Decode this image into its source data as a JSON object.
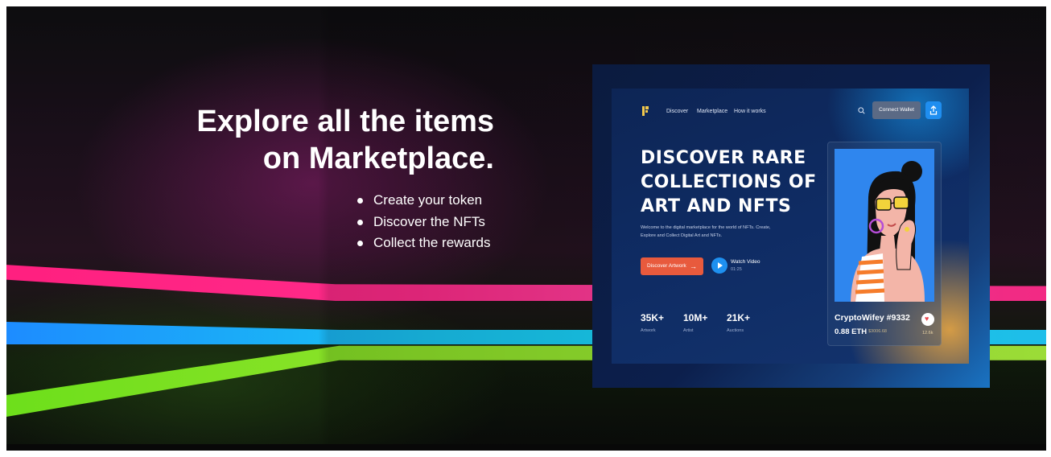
{
  "headline": {
    "line1": "Explore all the items",
    "line2": "on Marketplace."
  },
  "bullets": [
    "Create your token",
    "Discover the NFTs",
    "Collect the rewards"
  ],
  "mockup": {
    "nav": {
      "items": [
        "Discover",
        "Marketplace",
        "How it works"
      ],
      "connect_label": "Connect Wallet"
    },
    "hero": {
      "line1": "DISCOVER RARE",
      "line2": "COLLECTIONS OF",
      "line3": "ART AND NFTS",
      "desc_line1": "Welcome to the digital marketplace for the world of NFTs. Create,",
      "desc_line2": "Explore and Collect Digital Art and NFTs."
    },
    "discover_label": "Discover Artwork",
    "discover_arrow": "→",
    "watch_label": "Watch Video",
    "watch_time": "01:25",
    "stats": [
      {
        "value": "35K+",
        "label": "Artwork"
      },
      {
        "value": "10M+",
        "label": "Artist"
      },
      {
        "value": "21K+",
        "label": "Auctions"
      }
    ],
    "nft": {
      "title": "CryptoWifey #9332",
      "price": "0.88 ETH",
      "usd": "$3006.68",
      "likes": "12.6k"
    }
  },
  "colors": {
    "pink": "#ff2b8a",
    "blue": "#19c4f2",
    "green": "#8fe32a",
    "discover_button": "#e85a3d",
    "accent_blue": "#1f8ef0"
  },
  "icons": [
    "logo-icon",
    "search-icon",
    "share-icon",
    "play-icon",
    "heart-icon",
    "arrow-right-icon"
  ]
}
